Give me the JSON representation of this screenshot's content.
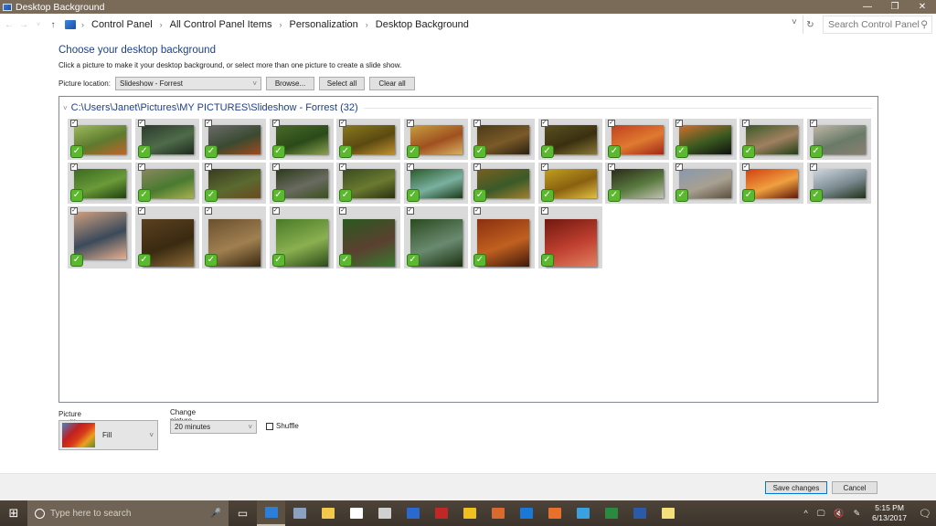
{
  "window": {
    "title": "Desktop Background",
    "controls": {
      "minimize": "—",
      "maximize": "❐",
      "close": "✕"
    }
  },
  "address": {
    "back_icon": "←",
    "forward_icon": "→",
    "recent_icon": "˅",
    "up_icon": "↑",
    "breadcrumbs": [
      "Control Panel",
      "All Control Panel Items",
      "Personalization",
      "Desktop Background"
    ],
    "separator": "›",
    "dropdown_icon": "˅",
    "refresh_icon": "↻",
    "search_placeholder": "Search Control Panel",
    "search_icon": "⚲"
  },
  "page": {
    "heading": "Choose your desktop background",
    "subtext": "Click a picture to make it your desktop background, or select more than one picture to create a slide show.",
    "picture_location_label": "Picture location:",
    "picture_location_value": "Slideshow - Forrest",
    "browse_label": "Browse...",
    "select_all_label": "Select all",
    "clear_all_label": "Clear all"
  },
  "gallery": {
    "group_title": "C:\\Users\\Janet\\Pictures\\MY PICTURES\\Slideshow - Forrest (32)",
    "count": 32,
    "pictures": [
      {
        "colors": [
          "#9dbb5e",
          "#5e7a2e",
          "#c0642a"
        ],
        "selected": true
      },
      {
        "colors": [
          "#2c3a2c",
          "#4f6b4a",
          "#1e2a1e"
        ],
        "selected": true
      },
      {
        "colors": [
          "#6b6b6b",
          "#3a4a30",
          "#a04a20"
        ],
        "selected": true
      },
      {
        "colors": [
          "#4a6a2a",
          "#2a4a18",
          "#8aa050"
        ],
        "selected": true
      },
      {
        "colors": [
          "#8a7a20",
          "#5a4a10",
          "#c09030"
        ],
        "selected": true
      },
      {
        "colors": [
          "#c8a040",
          "#a05020",
          "#d8b060"
        ],
        "selected": true
      },
      {
        "colors": [
          "#4a3a18",
          "#7a5a28",
          "#2a2010"
        ],
        "selected": true
      },
      {
        "colors": [
          "#5a5020",
          "#3a3010",
          "#8a7838"
        ],
        "selected": true
      },
      {
        "colors": [
          "#c04020",
          "#e07a30",
          "#a02818"
        ],
        "selected": true
      },
      {
        "colors": [
          "#d07030",
          "#3a5a20",
          "#101010"
        ],
        "selected": true
      },
      {
        "colors": [
          "#3a5a28",
          "#a08060",
          "#204018"
        ],
        "selected": true
      },
      {
        "colors": [
          "#c0b8a8",
          "#6a7a68",
          "#8a8070"
        ],
        "selected": true
      },
      {
        "colors": [
          "#3a6a20",
          "#6a9a38",
          "#204010"
        ],
        "selected": true
      },
      {
        "colors": [
          "#8a8860",
          "#4a7a30",
          "#a8b050"
        ],
        "selected": true
      },
      {
        "colors": [
          "#3a3a20",
          "#5a6a30",
          "#6a4a20"
        ],
        "selected": true
      },
      {
        "colors": [
          "#2a3a18",
          "#6a6a60",
          "#3a5020"
        ],
        "selected": true
      },
      {
        "colors": [
          "#3a4a20",
          "#6a7a30",
          "#2a3010"
        ],
        "selected": true
      },
      {
        "colors": [
          "#2a5a28",
          "#7ab0a0",
          "#1a3a18"
        ],
        "selected": true
      },
      {
        "colors": [
          "#7a6020",
          "#3a5a28",
          "#a08030"
        ],
        "selected": true
      },
      {
        "colors": [
          "#c0a020",
          "#8a6010",
          "#e0c040"
        ],
        "selected": true
      },
      {
        "colors": [
          "#2a2a18",
          "#5a7a40",
          "#c0c0b0"
        ],
        "selected": true
      },
      {
        "colors": [
          "#8898b0",
          "#a8a090",
          "#5a5040"
        ],
        "selected": true
      },
      {
        "colors": [
          "#d04010",
          "#f0a040",
          "#601808"
        ],
        "selected": true
      },
      {
        "colors": [
          "#d0d8e0",
          "#7a8a90",
          "#203018"
        ],
        "selected": true
      },
      {
        "colors": [
          "#d0a080",
          "#3a4a5a",
          "#e8b090"
        ],
        "selected": true,
        "tall": true
      },
      {
        "colors": [
          "#5a4020",
          "#3a2a10",
          "#8a6a38"
        ],
        "selected": true
      },
      {
        "colors": [
          "#6a5030",
          "#a08050",
          "#3a2810"
        ],
        "selected": true
      },
      {
        "colors": [
          "#4a7a28",
          "#8ab050",
          "#2a4a18"
        ],
        "selected": true
      },
      {
        "colors": [
          "#2a5a20",
          "#5a4030",
          "#3a7a30"
        ],
        "selected": true
      },
      {
        "colors": [
          "#2a4a20",
          "#6a8a70",
          "#1a3010"
        ],
        "selected": true
      },
      {
        "colors": [
          "#8a3010",
          "#c06020",
          "#401808"
        ],
        "selected": true
      },
      {
        "colors": [
          "#701810",
          "#c04030",
          "#e08060"
        ],
        "selected": true
      }
    ]
  },
  "options": {
    "picture_position_label": "Picture position:",
    "picture_position_value": "Fill",
    "change_every_label": "Change picture every:",
    "change_every_value": "20 minutes",
    "shuffle_label": "Shuffle",
    "shuffle_checked": false,
    "dropdown_icon": "˅"
  },
  "footer": {
    "save_label": "Save changes",
    "cancel_label": "Cancel"
  },
  "taskbar": {
    "start_icon": "⊞",
    "search_placeholder": "Type here to search",
    "mic_icon": "🎤",
    "task_view_icon": "▭",
    "apps": [
      {
        "name": "control-panel",
        "color": "#2b7fd8",
        "active": true
      },
      {
        "name": "remote-desktop",
        "color": "#8aa2c0",
        "active": false
      },
      {
        "name": "file-explorer",
        "color": "#f4c84a",
        "active": false
      },
      {
        "name": "store",
        "color": "#ffffff",
        "active": false
      },
      {
        "name": "alarms",
        "color": "#d0d0d0",
        "active": false
      },
      {
        "name": "malwarebytes",
        "color": "#2a6ad0",
        "active": false
      },
      {
        "name": "xmind",
        "color": "#c02828",
        "active": false
      },
      {
        "name": "norton",
        "color": "#f0c020",
        "active": false
      },
      {
        "name": "media-player",
        "color": "#d86a30",
        "active": false
      },
      {
        "name": "edge",
        "color": "#1a78d8",
        "active": false
      },
      {
        "name": "firefox",
        "color": "#e8702a",
        "active": false
      },
      {
        "name": "internet-explorer",
        "color": "#3aa0e0",
        "active": false
      },
      {
        "name": "excel",
        "color": "#2a8a40",
        "active": false
      },
      {
        "name": "word",
        "color": "#2a5aa8",
        "active": false
      },
      {
        "name": "sticky-notes",
        "color": "#f4e07a",
        "active": false
      }
    ],
    "tray": {
      "chevron_icon": "^",
      "network_icon": "🖵",
      "volume_icon": "🔇",
      "pen_icon": "✎",
      "time": "5:15 PM",
      "date": "6/13/2017",
      "notification_count": "1",
      "notification_icon": "🗨"
    }
  }
}
